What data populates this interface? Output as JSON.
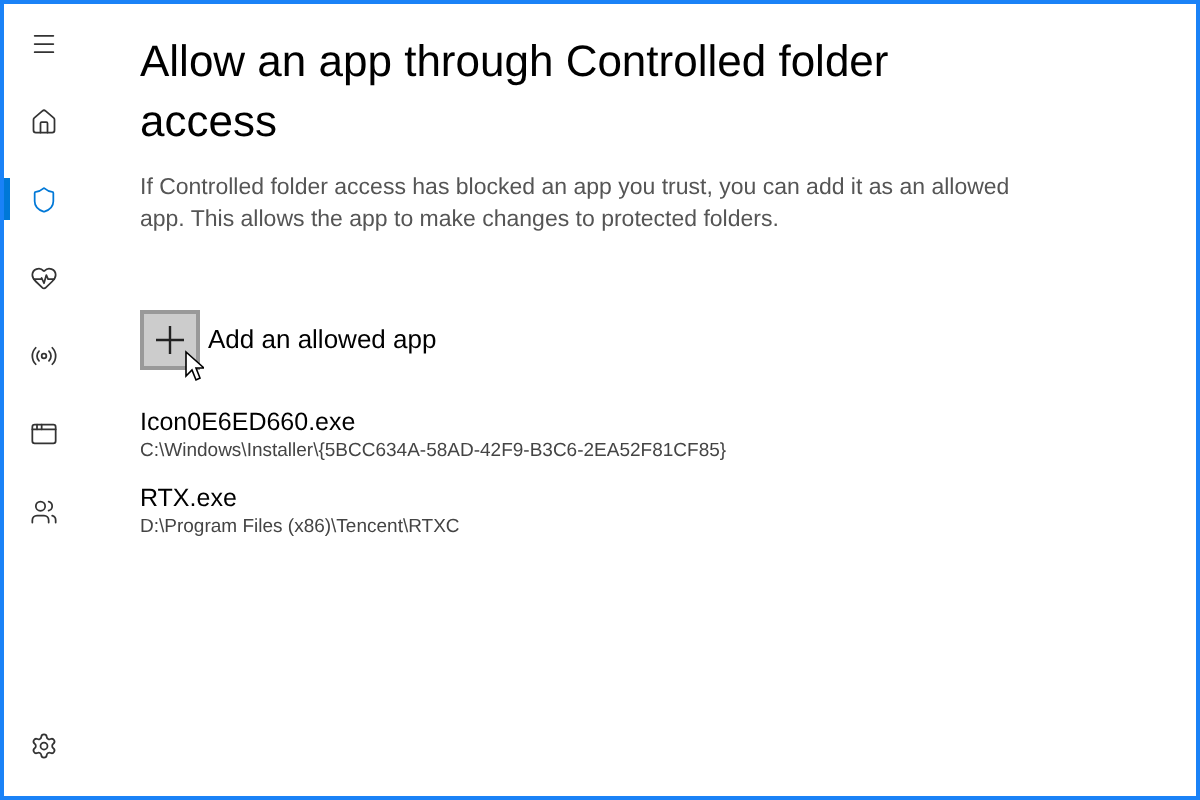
{
  "sidebar": {
    "items": [
      {
        "kind": "menu",
        "selected": false
      },
      {
        "kind": "home",
        "selected": false
      },
      {
        "kind": "shield",
        "selected": true
      },
      {
        "kind": "health",
        "selected": false
      },
      {
        "kind": "network",
        "selected": false
      },
      {
        "kind": "app",
        "selected": false
      },
      {
        "kind": "family",
        "selected": false
      }
    ],
    "footer": {
      "kind": "settings"
    }
  },
  "title": "Allow an app through Controlled folder access",
  "description": "If Controlled folder access has blocked an app you trust, you can add it as an allowed app. This allows the app to make changes to protected folders.",
  "add_button": {
    "label": "Add an allowed app",
    "hovered": true
  },
  "apps": [
    {
      "name": "Icon0E6ED660.exe",
      "path": "C:\\Windows\\Installer\\{5BCC634A-58AD-42F9-B3C6-2EA52F81CF85}"
    },
    {
      "name": "RTX.exe",
      "path": "D:\\Program Files (x86)\\Tencent\\RTXC"
    }
  ]
}
